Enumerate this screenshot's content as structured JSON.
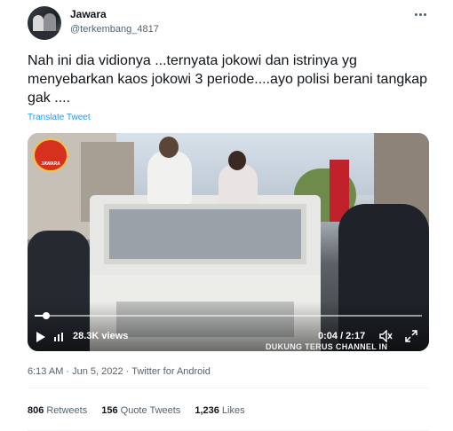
{
  "tweet": {
    "author": {
      "name": "Jawara",
      "handle": "@terkembang_4817"
    },
    "text": "Nah ini dia vidionya ...ternyata jokowi dan istrinya yg menyebarkan kaos jokowi 3 periode....ayo polisi berani tangkap gak ....",
    "translate_label": "Translate Tweet",
    "video": {
      "views": "28.3K views",
      "time": "0:04 / 2:17",
      "progress": 0.03,
      "overlay_caption": "DUKUNG TERUS CHANNEL IN",
      "logo_text": "JAWARA"
    },
    "meta": "6:13 AM · Jun 5, 2022 · Twitter for Android",
    "stats": {
      "retweets_count": "806",
      "retweets_label": "Retweets",
      "quotes_count": "156",
      "quotes_label": "Quote Tweets",
      "likes_count": "1,236",
      "likes_label": "Likes"
    }
  },
  "icons": [
    "more-icon",
    "play-icon",
    "views-icon",
    "volume-icon",
    "fullscreen-icon"
  ],
  "colors": {
    "text": "#0f1419",
    "secondary": "#536471",
    "link": "#1d9bf0",
    "divider": "#eff3f4"
  }
}
